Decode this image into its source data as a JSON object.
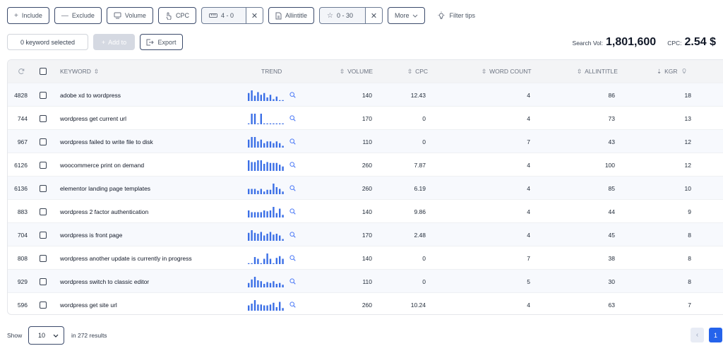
{
  "filters": {
    "include": "Include",
    "exclude": "Exclude",
    "volume": "Volume",
    "cpc": "CPC",
    "word_count_range": "4 - 0",
    "allintitle": "Allintitle",
    "kgr_range": "0 - 30",
    "more": "More",
    "filter_tips": "Filter tips"
  },
  "actions": {
    "selected": "0 keyword selected",
    "add_to": "Add to",
    "export": "Export"
  },
  "stats": {
    "search_vol_label": "Search Vol:",
    "search_vol_value": "1,801,600",
    "cpc_label": "CPC:",
    "cpc_value": "2.54 $"
  },
  "columns": {
    "keyword": "KEYWORD",
    "trend": "TREND",
    "volume": "VOLUME",
    "cpc": "CPC",
    "word_count": "WORD COUNT",
    "allintitle": "ALLINTITLE",
    "kgr": "KGR"
  },
  "trend_color": "#3b6fe6",
  "rows": [
    {
      "id": "4828",
      "keyword": "adobe xd to wordpress",
      "volume": "140",
      "cpc": "12.43",
      "word_count": "4",
      "allintitle": "86",
      "kgr": "18",
      "trend": [
        9,
        12,
        6,
        10,
        7,
        9,
        4,
        7,
        2,
        5,
        0,
        1
      ]
    },
    {
      "id": "744",
      "keyword": "wordpress get current url",
      "volume": "170",
      "cpc": "0",
      "word_count": "4",
      "allintitle": "73",
      "kgr": "13",
      "trend": [
        1,
        12,
        12,
        1,
        12,
        1,
        1,
        1,
        1,
        1,
        1,
        1
      ]
    },
    {
      "id": "967",
      "keyword": "wordpress failed to write file to disk",
      "volume": "110",
      "cpc": "0",
      "word_count": "7",
      "allintitle": "43",
      "kgr": "12",
      "trend": [
        9,
        12,
        12,
        7,
        9,
        5,
        7,
        7,
        5,
        7,
        5,
        2
      ]
    },
    {
      "id": "6126",
      "keyword": "woocommerce print on demand",
      "volume": "260",
      "cpc": "7.87",
      "word_count": "4",
      "allintitle": "100",
      "kgr": "12",
      "trend": [
        12,
        10,
        10,
        12,
        12,
        8,
        10,
        9,
        9,
        9,
        7,
        5
      ]
    },
    {
      "id": "6136",
      "keyword": "elementor landing page templates",
      "volume": "260",
      "cpc": "6.19",
      "word_count": "4",
      "allintitle": "85",
      "kgr": "10",
      "trend": [
        6,
        6,
        6,
        4,
        6,
        3,
        5,
        5,
        12,
        8,
        6,
        3
      ]
    },
    {
      "id": "883",
      "keyword": "wordpress 2 factor authentication",
      "volume": "140",
      "cpc": "9.86",
      "word_count": "4",
      "allintitle": "44",
      "kgr": "9",
      "trend": [
        8,
        6,
        6,
        6,
        6,
        8,
        7,
        8,
        12,
        5,
        10,
        3
      ]
    },
    {
      "id": "704",
      "keyword": "wordpress is front page",
      "volume": "170",
      "cpc": "2.48",
      "word_count": "4",
      "allintitle": "45",
      "kgr": "8",
      "trend": [
        9,
        12,
        9,
        8,
        10,
        6,
        8,
        10,
        7,
        8,
        6,
        2
      ]
    },
    {
      "id": "808",
      "keyword": "wordpress another update is currently in progress",
      "volume": "140",
      "cpc": "0",
      "word_count": "7",
      "allintitle": "38",
      "kgr": "8",
      "trend": [
        1,
        1,
        8,
        6,
        1,
        6,
        12,
        6,
        1,
        7,
        9,
        6
      ]
    },
    {
      "id": "929",
      "keyword": "wordpress switch to classic editor",
      "volume": "110",
      "cpc": "0",
      "word_count": "5",
      "allintitle": "30",
      "kgr": "8",
      "trend": [
        5,
        9,
        12,
        8,
        7,
        4,
        6,
        5,
        7,
        4,
        5,
        3
      ]
    },
    {
      "id": "596",
      "keyword": "wordpress get site url",
      "volume": "260",
      "cpc": "10.24",
      "word_count": "4",
      "allintitle": "63",
      "kgr": "7",
      "trend": [
        6,
        8,
        12,
        7,
        7,
        6,
        6,
        7,
        9,
        4,
        10,
        3
      ]
    }
  ],
  "pager": {
    "show_label": "Show",
    "page_size": "10",
    "results": "in 272 results",
    "current_page": "1"
  }
}
